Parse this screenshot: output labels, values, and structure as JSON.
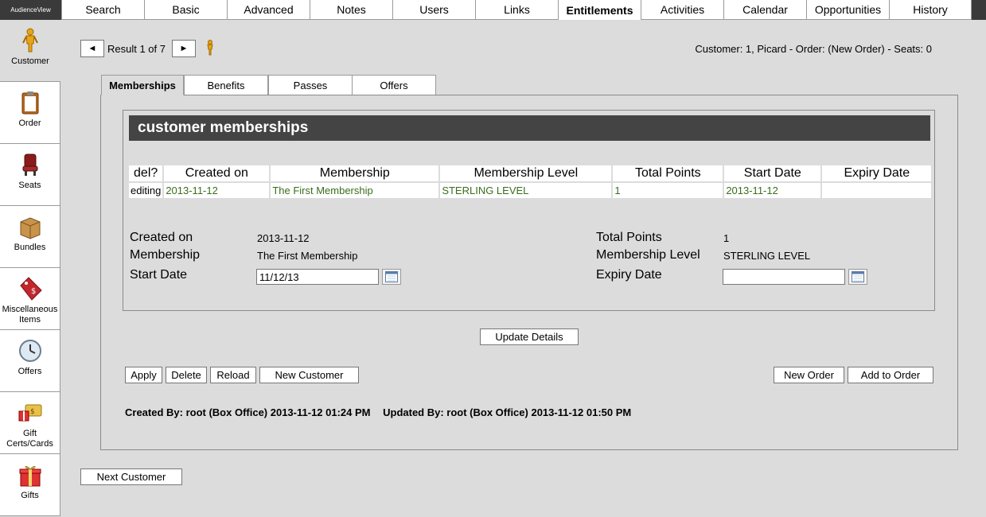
{
  "app": {
    "logo": "AudienceView"
  },
  "top_tabs": [
    {
      "label": "Search",
      "active": false
    },
    {
      "label": "Basic",
      "active": false
    },
    {
      "label": "Advanced",
      "active": false
    },
    {
      "label": "Notes",
      "active": false
    },
    {
      "label": "Users",
      "active": false
    },
    {
      "label": "Links",
      "active": false
    },
    {
      "label": "Entitlements",
      "active": true
    },
    {
      "label": "Activities",
      "active": false
    },
    {
      "label": "Calendar",
      "active": false
    },
    {
      "label": "Opportunities",
      "active": false
    },
    {
      "label": "History",
      "active": false
    }
  ],
  "sidebar": {
    "items": [
      {
        "label": "Customer",
        "icon": "customer-icon",
        "active": true
      },
      {
        "label": "Order",
        "icon": "clipboard-icon",
        "active": false
      },
      {
        "label": "Seats",
        "icon": "seat-icon",
        "active": false
      },
      {
        "label": "Bundles",
        "icon": "box-icon",
        "active": false
      },
      {
        "label": "Miscellaneous Items",
        "icon": "price-tag-icon",
        "active": false
      },
      {
        "label": "Offers",
        "icon": "clock-icon",
        "active": false
      },
      {
        "label": "Gift Certs/Cards",
        "icon": "gift-card-icon",
        "active": false
      },
      {
        "label": "Gifts",
        "icon": "gift-icon",
        "active": false
      }
    ]
  },
  "navigator": {
    "prev": "◄",
    "next": "►",
    "result_label": "Result 1 of 7"
  },
  "summary": "Customer: 1, Picard - Order: (New Order) - Seats: 0",
  "sub_tabs": [
    {
      "label": "Memberships",
      "active": true
    },
    {
      "label": "Benefits",
      "active": false
    },
    {
      "label": "Passes",
      "active": false
    },
    {
      "label": "Offers",
      "active": false
    }
  ],
  "section_title": "customer memberships",
  "table": {
    "headers": [
      "del?",
      "Created on",
      "Membership",
      "Membership Level",
      "Total Points",
      "Start Date",
      "Expiry Date"
    ],
    "rows": [
      [
        "editing",
        "2013-11-12",
        "The First Membership",
        "STERLING LEVEL",
        "1",
        "2013-11-12",
        ""
      ]
    ]
  },
  "details": {
    "created_on_label": "Created on",
    "created_on_value": "2013-11-12",
    "membership_label": "Membership",
    "membership_value": "The First Membership",
    "start_date_label": "Start Date",
    "start_date_value": "11/12/13",
    "total_points_label": "Total Points",
    "total_points_value": "1",
    "membership_level_label": "Membership Level",
    "membership_level_value": "STERLING LEVEL",
    "expiry_date_label": "Expiry Date",
    "expiry_date_value": ""
  },
  "buttons": {
    "update_details": "Update Details",
    "apply": "Apply",
    "delete": "Delete",
    "reload": "Reload",
    "new_customer": "New Customer",
    "new_order": "New Order",
    "add_to_order": "Add to Order",
    "next_customer": "Next Customer"
  },
  "audit": {
    "created": "Created By: root (Box Office) 2013-11-12 01:24 PM",
    "updated": "Updated By: root (Box Office) 2013-11-12 01:50 PM"
  }
}
